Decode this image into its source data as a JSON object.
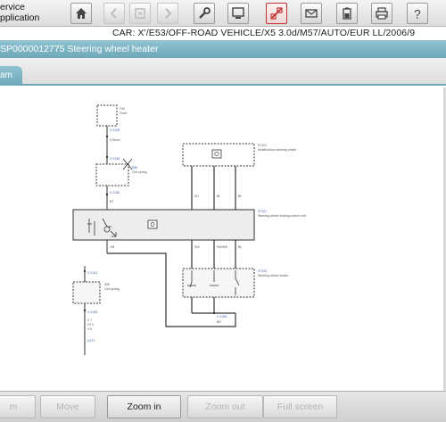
{
  "app": {
    "title_line1": "ervice",
    "title_line2": "pplication"
  },
  "toolbar": {
    "buttons": [
      {
        "icon": "home-icon",
        "state": "enabled"
      },
      {
        "icon": "back-icon",
        "state": "disabled"
      },
      {
        "icon": "mark-icon",
        "state": "disabled"
      },
      {
        "icon": "forward-icon",
        "state": "disabled"
      },
      {
        "icon": "wrench-icon",
        "state": "enabled"
      },
      {
        "icon": "display-icon",
        "state": "enabled"
      },
      {
        "icon": "connection-icon",
        "state": "active"
      },
      {
        "icon": "mail-icon",
        "state": "enabled"
      },
      {
        "icon": "battery-icon",
        "state": "enabled"
      },
      {
        "icon": "print-icon",
        "state": "enabled"
      },
      {
        "icon": "help-icon",
        "state": "enabled"
      }
    ]
  },
  "car_line": "CAR:  X'/E53/OFF-ROAD VEHICLE/X5 3.0d/M57/AUTO/EUR LL/2006/9",
  "document": {
    "title": "SP0000012775 Steering wheel heater"
  },
  "tabs": [
    {
      "label": "am"
    }
  ],
  "diagram": {
    "labels": {
      "f_label": "F40",
      "f_sub": "Fuse",
      "x_top": "X 2105",
      "wire_top": "0.5mm²",
      "coil_label": "S50",
      "coil_sub": "Coil spring",
      "x_mid": "X 2136",
      "x_mid2": "X 2136",
      "wire_bt": "BT",
      "mfsw_label": "S7101",
      "mfsw_sub": "Multifunction steering wheel",
      "wire_1": "SH",
      "wire_2": "BL",
      "wire_3": "BL",
      "ctrl_label": "S7101",
      "ctrl_sub": "Steering wheel heating control unit",
      "wire_gn": "GN",
      "wire_sw": "SW",
      "wire_swws": "SW/WS",
      "wire_bl": "BL",
      "heater_label": "S7100",
      "heater_sub": "Steering wheel heater",
      "x_left": "X 2131",
      "left_box_label": "S50",
      "left_box_sub": "Coil spring",
      "x_low": "X 2106",
      "x_bottom": "X 2108",
      "wire_br": "BR",
      "ground_label": "X 7",
      "ground_sub": "GTV",
      "wire_bottom": "0.5",
      "ground_link": "X2T1"
    }
  },
  "bottom": {
    "buttons": [
      {
        "label": "m",
        "enabled": false
      },
      {
        "label": "Move",
        "enabled": false
      },
      {
        "label": "Zoom in",
        "enabled": true
      },
      {
        "label": "Zoom out",
        "enabled": false
      },
      {
        "label": "Full screen",
        "enabled": false
      }
    ]
  }
}
